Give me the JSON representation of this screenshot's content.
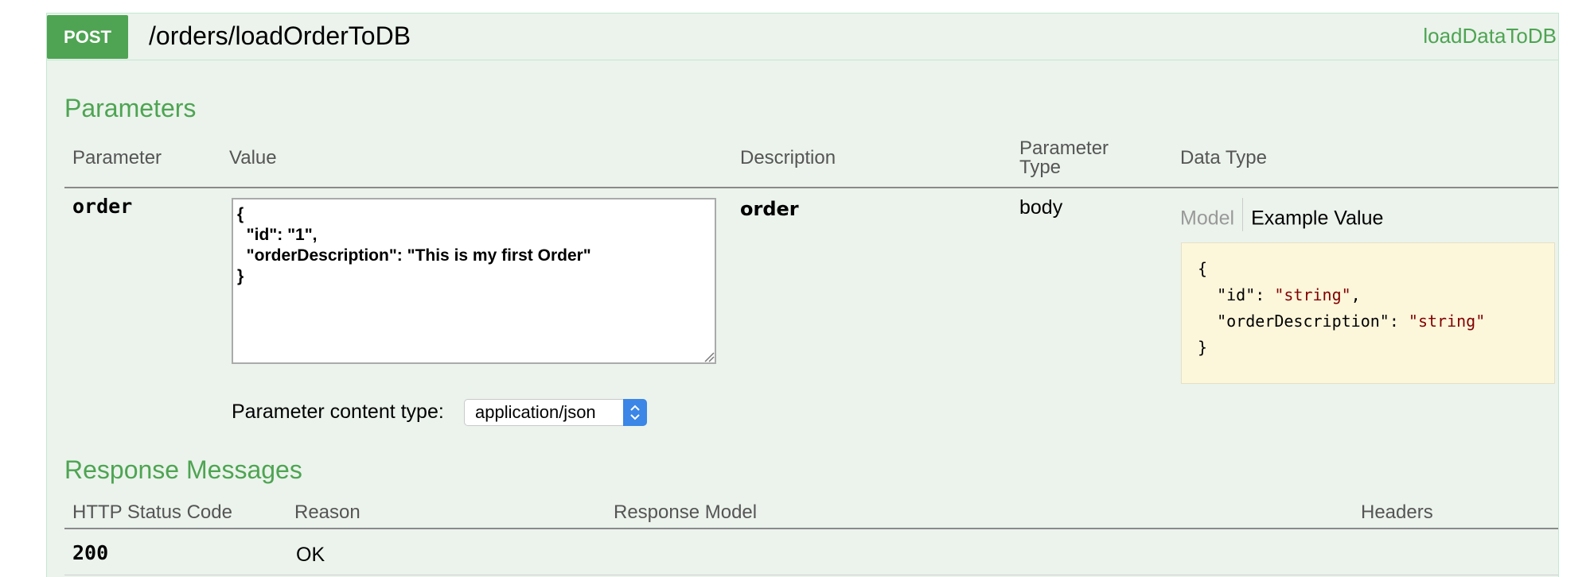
{
  "operation": {
    "method": "POST",
    "path": "/orders/loadOrderToDB",
    "nickname": "loadDataToDB"
  },
  "parameters": {
    "title": "Parameters",
    "columns": {
      "parameter": "Parameter",
      "value": "Value",
      "description": "Description",
      "parameter_type_line1": "Parameter",
      "parameter_type_line2": "Type",
      "data_type": "Data Type"
    },
    "rows": [
      {
        "name": "order",
        "value": "{\n  \"id\": \"1\",\n  \"orderDescription\": \"This is my first Order\"\n}",
        "description": "order",
        "parameter_type": "body"
      }
    ],
    "data_type_tabs": {
      "model": "Model",
      "example": "Example Value"
    },
    "example_value": {
      "open": "{",
      "id_key": "\"id\": ",
      "id_val": "\"string\"",
      "id_comma": ",",
      "desc_key": "\"orderDescription\": ",
      "desc_val": "\"string\"",
      "close": "}"
    },
    "content_type_label": "Parameter content type:",
    "content_type_selected": "application/json"
  },
  "responses": {
    "title": "Response Messages",
    "columns": {
      "status": "HTTP Status Code",
      "reason": "Reason",
      "model": "Response Model",
      "headers": "Headers"
    },
    "rows": [
      {
        "status": "200",
        "reason": "OK"
      }
    ]
  },
  "colors": {
    "accent_green": "#4ea452",
    "panel_bg": "#ebf3ec",
    "example_bg": "#fcf6db",
    "string_color": "#800000",
    "select_blue": "#3b86e6"
  }
}
